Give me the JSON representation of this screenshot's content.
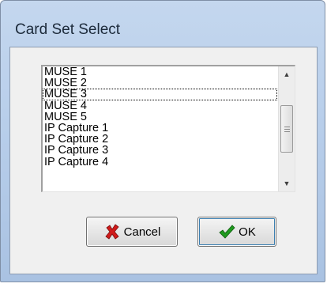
{
  "window": {
    "title": "Card Set Select"
  },
  "list": {
    "items": [
      "MUSE 1",
      "MUSE 2",
      "MUSE 3",
      "MUSE 4",
      "MUSE 5",
      "IP Capture 1",
      "IP Capture 2",
      "IP Capture 3",
      "IP Capture 4"
    ],
    "focused_index": 2
  },
  "buttons": {
    "cancel_label": "Cancel",
    "ok_label": "OK",
    "cancel_icon": "red-x-icon",
    "ok_icon": "green-checkmark-icon"
  },
  "colors": {
    "title_bar": "#b9cfeb",
    "cancel_icon": "#d11b1b",
    "ok_icon": "#1f9a1f"
  }
}
